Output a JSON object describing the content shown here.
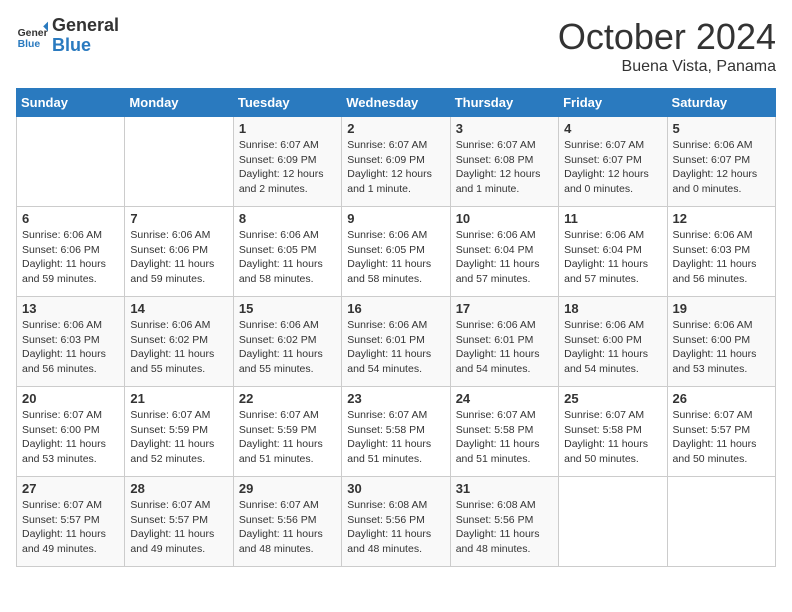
{
  "header": {
    "logo_text_general": "General",
    "logo_text_blue": "Blue",
    "month_title": "October 2024",
    "location": "Buena Vista, Panama"
  },
  "days_of_week": [
    "Sunday",
    "Monday",
    "Tuesday",
    "Wednesday",
    "Thursday",
    "Friday",
    "Saturday"
  ],
  "weeks": [
    [
      {
        "day": "",
        "info": ""
      },
      {
        "day": "",
        "info": ""
      },
      {
        "day": "1",
        "info": "Sunrise: 6:07 AM\nSunset: 6:09 PM\nDaylight: 12 hours\nand 2 minutes."
      },
      {
        "day": "2",
        "info": "Sunrise: 6:07 AM\nSunset: 6:09 PM\nDaylight: 12 hours\nand 1 minute."
      },
      {
        "day": "3",
        "info": "Sunrise: 6:07 AM\nSunset: 6:08 PM\nDaylight: 12 hours\nand 1 minute."
      },
      {
        "day": "4",
        "info": "Sunrise: 6:07 AM\nSunset: 6:07 PM\nDaylight: 12 hours\nand 0 minutes."
      },
      {
        "day": "5",
        "info": "Sunrise: 6:06 AM\nSunset: 6:07 PM\nDaylight: 12 hours\nand 0 minutes."
      }
    ],
    [
      {
        "day": "6",
        "info": "Sunrise: 6:06 AM\nSunset: 6:06 PM\nDaylight: 11 hours\nand 59 minutes."
      },
      {
        "day": "7",
        "info": "Sunrise: 6:06 AM\nSunset: 6:06 PM\nDaylight: 11 hours\nand 59 minutes."
      },
      {
        "day": "8",
        "info": "Sunrise: 6:06 AM\nSunset: 6:05 PM\nDaylight: 11 hours\nand 58 minutes."
      },
      {
        "day": "9",
        "info": "Sunrise: 6:06 AM\nSunset: 6:05 PM\nDaylight: 11 hours\nand 58 minutes."
      },
      {
        "day": "10",
        "info": "Sunrise: 6:06 AM\nSunset: 6:04 PM\nDaylight: 11 hours\nand 57 minutes."
      },
      {
        "day": "11",
        "info": "Sunrise: 6:06 AM\nSunset: 6:04 PM\nDaylight: 11 hours\nand 57 minutes."
      },
      {
        "day": "12",
        "info": "Sunrise: 6:06 AM\nSunset: 6:03 PM\nDaylight: 11 hours\nand 56 minutes."
      }
    ],
    [
      {
        "day": "13",
        "info": "Sunrise: 6:06 AM\nSunset: 6:03 PM\nDaylight: 11 hours\nand 56 minutes."
      },
      {
        "day": "14",
        "info": "Sunrise: 6:06 AM\nSunset: 6:02 PM\nDaylight: 11 hours\nand 55 minutes."
      },
      {
        "day": "15",
        "info": "Sunrise: 6:06 AM\nSunset: 6:02 PM\nDaylight: 11 hours\nand 55 minutes."
      },
      {
        "day": "16",
        "info": "Sunrise: 6:06 AM\nSunset: 6:01 PM\nDaylight: 11 hours\nand 54 minutes."
      },
      {
        "day": "17",
        "info": "Sunrise: 6:06 AM\nSunset: 6:01 PM\nDaylight: 11 hours\nand 54 minutes."
      },
      {
        "day": "18",
        "info": "Sunrise: 6:06 AM\nSunset: 6:00 PM\nDaylight: 11 hours\nand 54 minutes."
      },
      {
        "day": "19",
        "info": "Sunrise: 6:06 AM\nSunset: 6:00 PM\nDaylight: 11 hours\nand 53 minutes."
      }
    ],
    [
      {
        "day": "20",
        "info": "Sunrise: 6:07 AM\nSunset: 6:00 PM\nDaylight: 11 hours\nand 53 minutes."
      },
      {
        "day": "21",
        "info": "Sunrise: 6:07 AM\nSunset: 5:59 PM\nDaylight: 11 hours\nand 52 minutes."
      },
      {
        "day": "22",
        "info": "Sunrise: 6:07 AM\nSunset: 5:59 PM\nDaylight: 11 hours\nand 51 minutes."
      },
      {
        "day": "23",
        "info": "Sunrise: 6:07 AM\nSunset: 5:58 PM\nDaylight: 11 hours\nand 51 minutes."
      },
      {
        "day": "24",
        "info": "Sunrise: 6:07 AM\nSunset: 5:58 PM\nDaylight: 11 hours\nand 51 minutes."
      },
      {
        "day": "25",
        "info": "Sunrise: 6:07 AM\nSunset: 5:58 PM\nDaylight: 11 hours\nand 50 minutes."
      },
      {
        "day": "26",
        "info": "Sunrise: 6:07 AM\nSunset: 5:57 PM\nDaylight: 11 hours\nand 50 minutes."
      }
    ],
    [
      {
        "day": "27",
        "info": "Sunrise: 6:07 AM\nSunset: 5:57 PM\nDaylight: 11 hours\nand 49 minutes."
      },
      {
        "day": "28",
        "info": "Sunrise: 6:07 AM\nSunset: 5:57 PM\nDaylight: 11 hours\nand 49 minutes."
      },
      {
        "day": "29",
        "info": "Sunrise: 6:07 AM\nSunset: 5:56 PM\nDaylight: 11 hours\nand 48 minutes."
      },
      {
        "day": "30",
        "info": "Sunrise: 6:08 AM\nSunset: 5:56 PM\nDaylight: 11 hours\nand 48 minutes."
      },
      {
        "day": "31",
        "info": "Sunrise: 6:08 AM\nSunset: 5:56 PM\nDaylight: 11 hours\nand 48 minutes."
      },
      {
        "day": "",
        "info": ""
      },
      {
        "day": "",
        "info": ""
      }
    ]
  ]
}
